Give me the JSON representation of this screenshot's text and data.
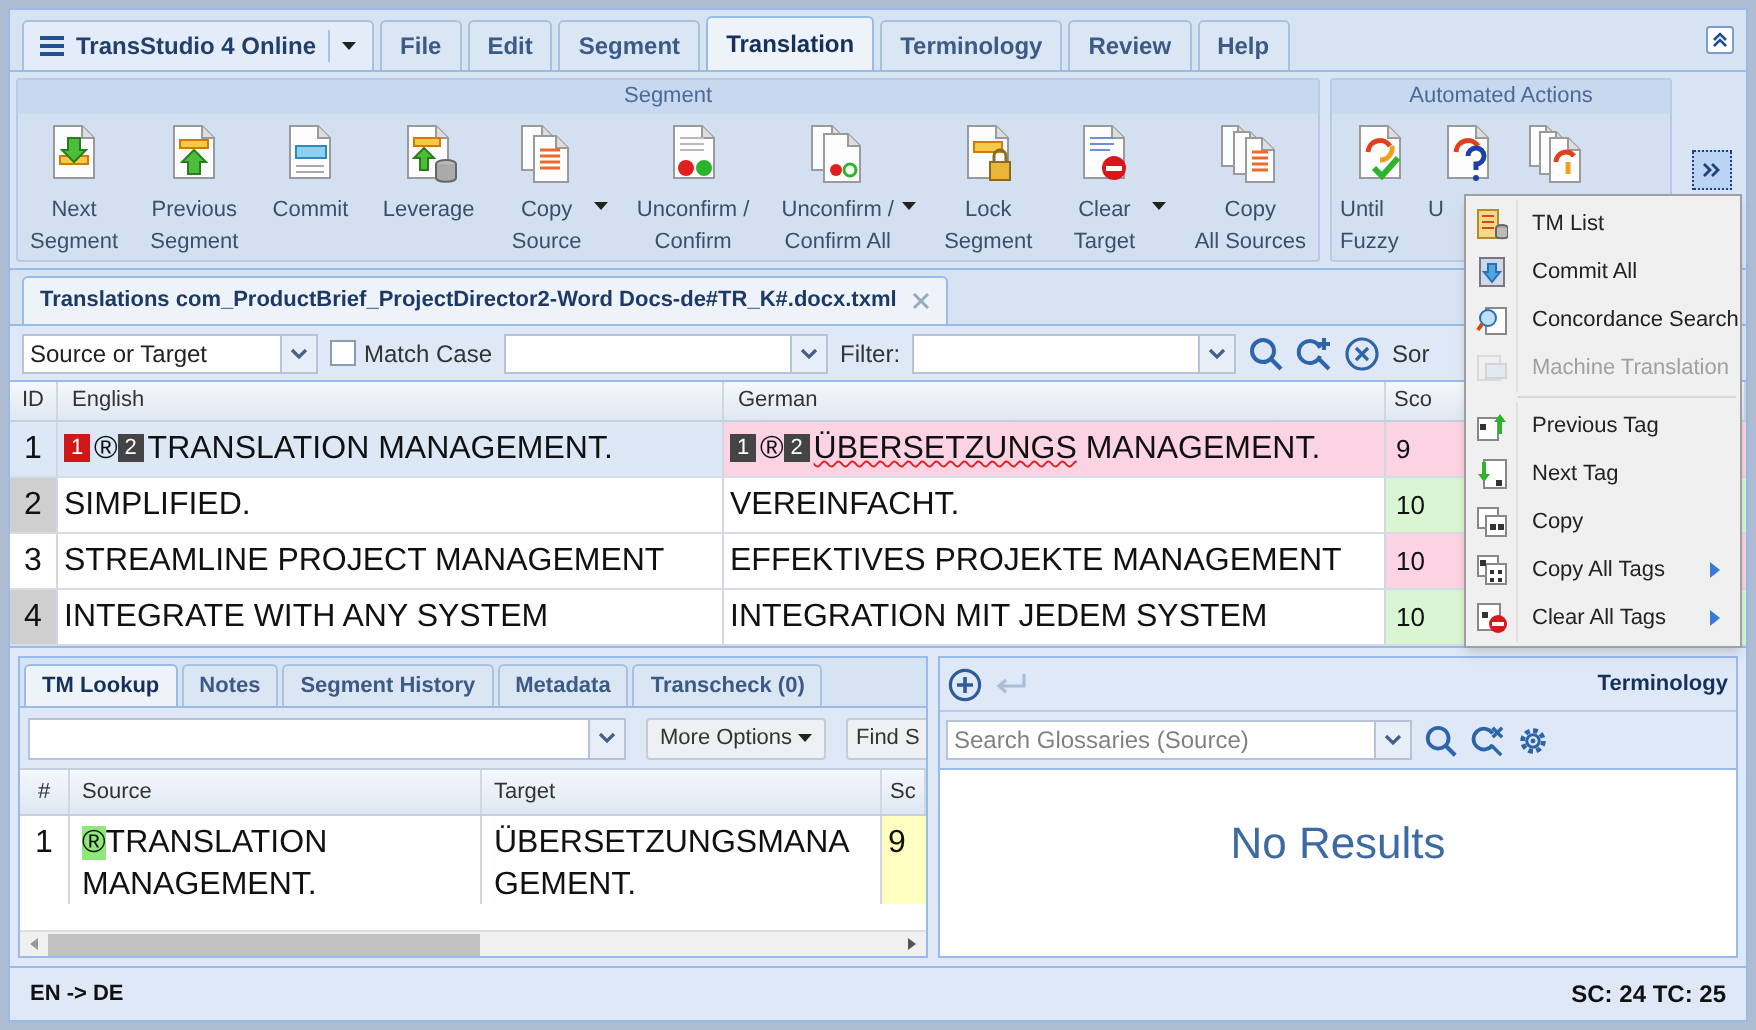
{
  "app_menu": {
    "label": "TransStudio 4 Online"
  },
  "menu_tabs": [
    {
      "label": "File",
      "selected": false
    },
    {
      "label": "Edit",
      "selected": false
    },
    {
      "label": "Segment",
      "selected": false
    },
    {
      "label": "Translation",
      "selected": true
    },
    {
      "label": "Terminology",
      "selected": false
    },
    {
      "label": "Review",
      "selected": false
    },
    {
      "label": "Help",
      "selected": false
    }
  ],
  "ribbon": {
    "groups": [
      {
        "title": "Segment",
        "buttons": [
          {
            "label": "Next\nSegment",
            "dropdown": false
          },
          {
            "label": "Previous\nSegment",
            "dropdown": false
          },
          {
            "label": "Commit",
            "dropdown": false
          },
          {
            "label": "Leverage",
            "dropdown": false
          },
          {
            "label": "Copy\nSource",
            "dropdown": true
          },
          {
            "label": "Unconfirm /\nConfirm",
            "dropdown": false
          },
          {
            "label": "Unconfirm /\nConfirm All",
            "dropdown": true
          },
          {
            "label": "Lock\nSegment",
            "dropdown": false
          },
          {
            "label": "Clear\nTarget",
            "dropdown": true
          },
          {
            "label": "Copy\nAll Sources",
            "dropdown": false
          }
        ]
      },
      {
        "title": "Automated Actions",
        "buttons": [
          {
            "label": "Until\nFuzzy",
            "dropdown": false
          },
          {
            "label": "U",
            "dropdown": false
          },
          {
            "dropdown": false
          }
        ]
      }
    ]
  },
  "document_tab": {
    "title": "Translations com_ProductBrief_ProjectDirector2-Word Docs-de#TR_K#.docx.txml"
  },
  "filter_bar": {
    "scope": "Source or Target",
    "match_case": {
      "label": "Match Case",
      "checked": false
    },
    "filter_label": "Filter:",
    "sort_label": "Sor"
  },
  "grid": {
    "columns": [
      "ID",
      "English",
      "German",
      "Sco"
    ],
    "rows": [
      {
        "id": "1",
        "selected": true,
        "source": [
          {
            "kind": "tag",
            "text": "1",
            "error": true
          },
          {
            "kind": "text",
            "text": "®"
          },
          {
            "kind": "tag",
            "text": "2",
            "error": false
          },
          {
            "kind": "text",
            "text": "TRANSLATION MANAGEMENT."
          }
        ],
        "target": [
          {
            "kind": "tag",
            "text": "1",
            "error": false
          },
          {
            "kind": "text",
            "text": "®"
          },
          {
            "kind": "tag",
            "text": "2",
            "error": false
          },
          {
            "kind": "text",
            "text": "ÜBERSETZUNGS",
            "misspelled": true
          },
          {
            "kind": "text",
            "text": " MANAGEMENT."
          }
        ],
        "target_highlighted": true,
        "score": "9",
        "color": "#fbd3e3"
      },
      {
        "id": "2",
        "selected": false,
        "source": [
          {
            "kind": "text",
            "text": "SIMPLIFIED."
          }
        ],
        "target": [
          {
            "kind": "text",
            "text": "VEREINFACHT."
          }
        ],
        "target_highlighted": false,
        "score": "10",
        "color": "#d9f5d2"
      },
      {
        "id": "3",
        "selected": false,
        "source": [
          {
            "kind": "text",
            "text": "STREAMLINE PROJECT MANAGEMENT"
          }
        ],
        "target": [
          {
            "kind": "text",
            "text": "EFFEKTIVES PROJEKTE MANAGEMENT"
          }
        ],
        "target_highlighted": false,
        "score": "10",
        "color": "#fbd3e3"
      },
      {
        "id": "4",
        "selected": false,
        "source": [
          {
            "kind": "text",
            "text": "INTEGRATE WITH ANY SYSTEM"
          }
        ],
        "target": [
          {
            "kind": "text",
            "text": "INTEGRATION MIT JEDEM SYSTEM"
          }
        ],
        "target_highlighted": false,
        "score": "10",
        "color": "#d9f5d2"
      }
    ]
  },
  "bottom_tabs": [
    {
      "label": "TM Lookup",
      "selected": true
    },
    {
      "label": "Notes",
      "selected": false
    },
    {
      "label": "Segment History",
      "selected": false
    },
    {
      "label": "Metadata",
      "selected": false
    },
    {
      "label": "Transcheck (0)",
      "selected": false
    }
  ],
  "tm_lookup": {
    "more_options": "More Options",
    "find_button": "Find S",
    "columns": [
      "#",
      "Source",
      "Target",
      "Sc"
    ],
    "rows": [
      {
        "num": "1",
        "source": [
          {
            "kind": "match_tag",
            "text": "®"
          },
          {
            "kind": "text",
            "text": "TRANSLATION MANAGEMENT."
          }
        ],
        "target": "ÜBERSETZUNGSMANAGEMENT.",
        "score": "9",
        "color": "#ffffc2"
      }
    ]
  },
  "terminology": {
    "title": "Terminology",
    "search_placeholder": "Search Glossaries (Source)",
    "empty_message": "No Results"
  },
  "status_bar": {
    "languages": "EN -> DE",
    "counts": "SC: 24 TC: 25"
  },
  "context_menu": {
    "items": [
      {
        "label": "TM List",
        "disabled": false,
        "submenu": false,
        "separator_before": false
      },
      {
        "label": "Commit All",
        "disabled": false,
        "submenu": false,
        "separator_before": false
      },
      {
        "label": "Concordance Search",
        "disabled": false,
        "submenu": false,
        "separator_before": false
      },
      {
        "label": "Machine Translation",
        "disabled": true,
        "submenu": false,
        "separator_before": false
      },
      {
        "label": "Previous Tag",
        "disabled": false,
        "submenu": false,
        "separator_before": true
      },
      {
        "label": "Next Tag",
        "disabled": false,
        "submenu": false,
        "separator_before": false
      },
      {
        "label": "Copy",
        "disabled": false,
        "submenu": false,
        "separator_before": false
      },
      {
        "label": "Copy All Tags",
        "disabled": false,
        "submenu": true,
        "separator_before": false
      },
      {
        "label": "Clear All Tags",
        "disabled": false,
        "submenu": true,
        "separator_before": false
      }
    ]
  }
}
